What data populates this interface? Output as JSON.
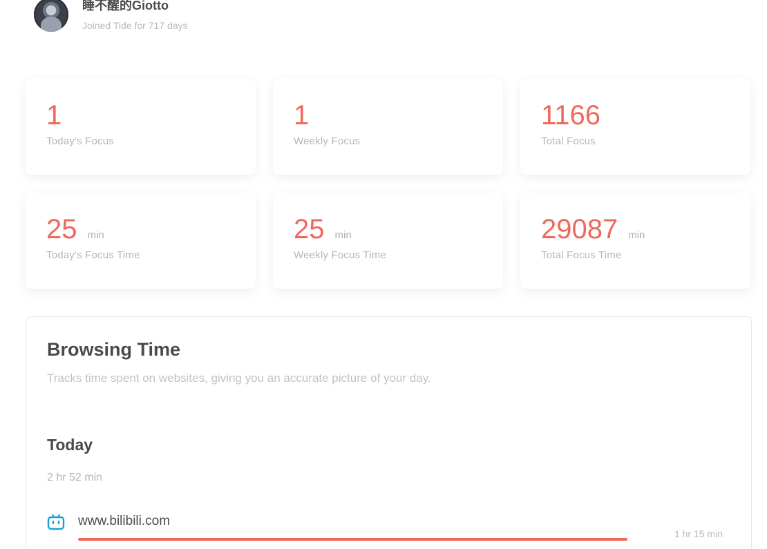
{
  "profile": {
    "username": "睡不醒的Giotto",
    "joined_text": "Joined Tide for 717 days"
  },
  "stats": [
    {
      "value": "1",
      "unit": "",
      "label": "Today's Focus"
    },
    {
      "value": "1",
      "unit": "",
      "label": "Weekly Focus"
    },
    {
      "value": "1166",
      "unit": "",
      "label": "Total Focus"
    },
    {
      "value": "25",
      "unit": "min",
      "label": "Today's Focus Time"
    },
    {
      "value": "25",
      "unit": "min",
      "label": "Weekly Focus Time"
    },
    {
      "value": "29087",
      "unit": "min",
      "label": "Total Focus Time"
    }
  ],
  "browsing": {
    "title": "Browsing Time",
    "description": "Tracks time spent on websites, giving you an accurate picture of your day.",
    "today_heading": "Today",
    "today_total": "2 hr 52 min",
    "sites": [
      {
        "name": "www.bilibili.com",
        "time": "1 hr 15 min",
        "icon": "bilibili-icon",
        "bar_fraction": 1.0
      }
    ]
  },
  "colors": {
    "accent": "#f0685c",
    "bilibili_icon": "#1aa2d6"
  }
}
